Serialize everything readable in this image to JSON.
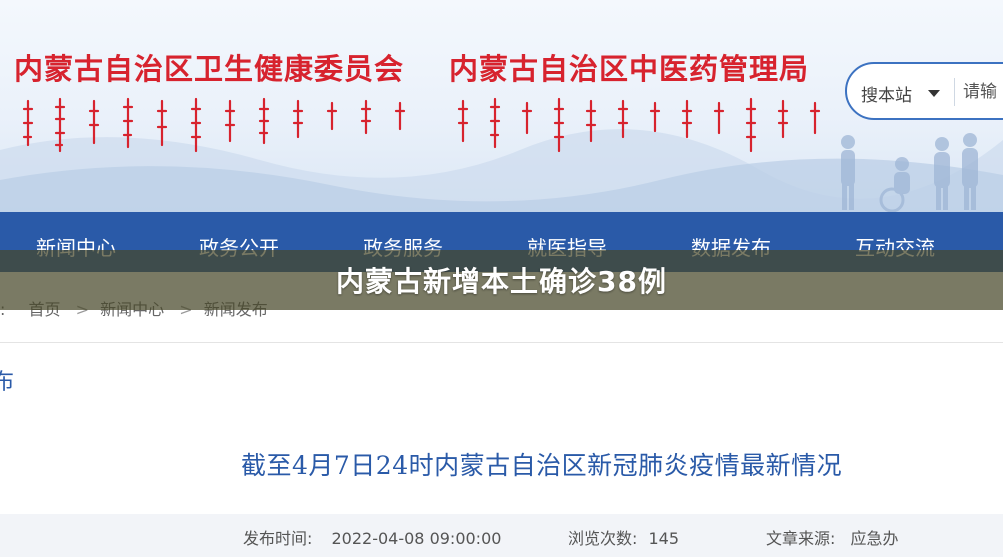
{
  "header": {
    "title_left": "内蒙古自治区卫生健康委员会",
    "title_right": "内蒙古自治区中医药管理局",
    "search": {
      "scope_label": "搜本站",
      "placeholder": "请输"
    }
  },
  "nav": {
    "items": [
      "新闻中心",
      "政务公开",
      "政务服务",
      "就医指导",
      "数据发布",
      "互动交流"
    ]
  },
  "breadcrumb": {
    "lead": ":",
    "items": [
      "首页",
      "新闻中心",
      "新闻发布"
    ]
  },
  "sidebar": {
    "fragment": "布"
  },
  "article": {
    "title": "截至4月7日24时内蒙古自治区新冠肺炎疫情最新情况",
    "publish_label": "发布时间:",
    "publish_value": "2022-04-08 09:00:00",
    "views_label": "浏览次数:",
    "views_value": "145",
    "source_label": "文章来源:",
    "source_value": "应急办"
  },
  "caption": {
    "text": "内蒙古新增本土确诊38例"
  },
  "colors": {
    "title_red": "#d7232e",
    "nav_blue": "#2a5aa8",
    "caption_bg": "#46462899"
  }
}
